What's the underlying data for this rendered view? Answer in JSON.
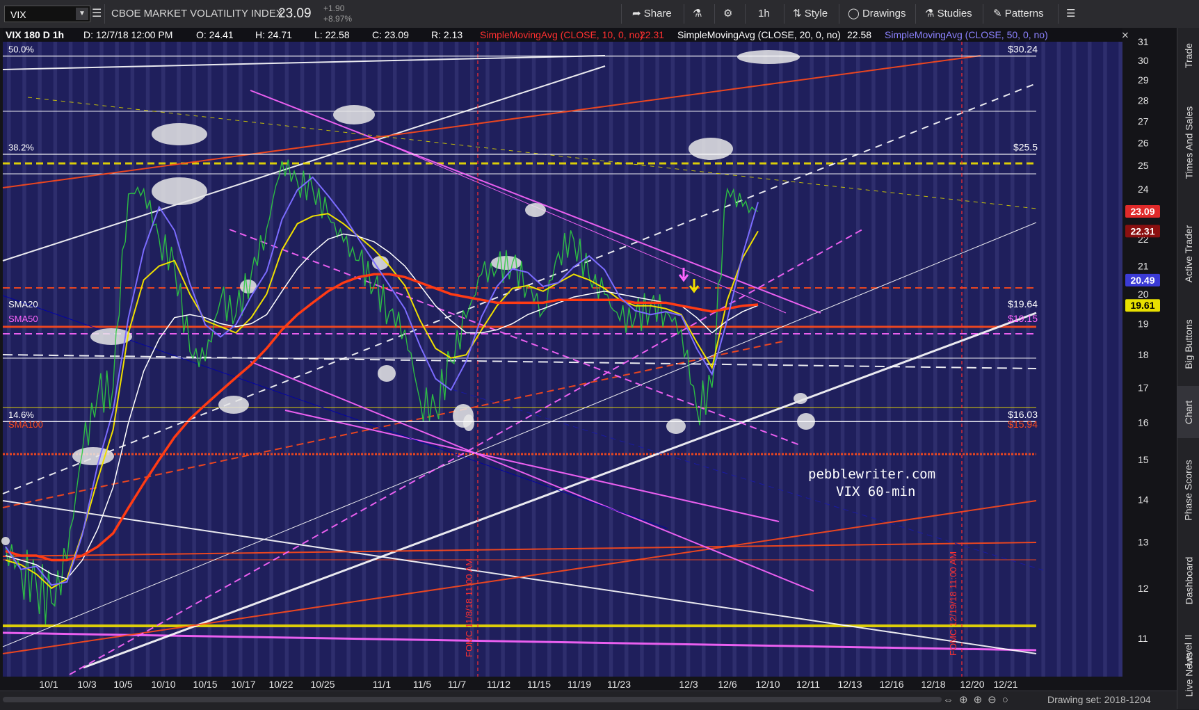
{
  "toolbar": {
    "symbol": "VIX",
    "full_name": "CBOE MARKET VOLATILITY INDEX",
    "last": "23.09",
    "change": "+1.90",
    "change_pct": "+8.97%",
    "share": "Share",
    "timeframe": "1h",
    "style": "Style",
    "drawings": "Drawings",
    "studies": "Studies",
    "patterns": "Patterns"
  },
  "sidebar": [
    "Trade",
    "Times And Sales",
    "Active Trader",
    "Big Buttons",
    "Chart",
    "Phase Scores",
    "Dashboard",
    "Level II",
    "Live News"
  ],
  "bottom": {
    "drawing_set": "Drawing set: 2018-1204"
  },
  "colors": {
    "background": "#1e1e5a",
    "stripe": "#3a3a7c",
    "sma10": "#ff2020",
    "sma20": "#ffffff",
    "sma50": "#7b6cff",
    "yellow": "#f0e000",
    "orange": "#ff4a1a",
    "magenta": "#ff66ff"
  },
  "chart_data": {
    "type": "line",
    "header": {
      "title": "VIX 180 D 1h",
      "date": "D: 12/7/18 12:00 PM",
      "open": "O: 24.41",
      "high": "H: 24.71",
      "low": "L: 22.58",
      "close": "C: 23.09",
      "range": "R: 2.13",
      "study1": "SimpleMovingAvg (CLOSE, 10, 0, no)",
      "study1_val": "22.31",
      "study2": "SimpleMovingAvg (CLOSE, 20, 0, no)",
      "study2_val": "22.58",
      "study3": "SimpleMovingAvg (CLOSE, 50, 0, no)"
    },
    "x_labels": [
      "10/1",
      "10/3",
      "10/5",
      "10/10",
      "10/15",
      "10/17",
      "10/22",
      "10/25",
      "11/1",
      "11/5",
      "11/7",
      "11/12",
      "11/15",
      "11/19",
      "11/23",
      "12/3",
      "12/6",
      "12/10",
      "12/11",
      "12/13",
      "12/16",
      "12/18",
      "12/20",
      "12/21"
    ],
    "y_ticks": [
      11,
      12,
      13,
      14,
      15,
      16,
      17,
      18,
      19,
      20,
      21,
      22,
      23,
      24,
      25,
      26,
      27,
      28,
      29,
      30,
      31
    ],
    "ylim": [
      11,
      31
    ],
    "fib_levels": [
      {
        "label": "50.0%",
        "value": 30.24,
        "price_label": "$30.24"
      },
      {
        "label": "38.2%",
        "value": 25.5,
        "price_label": "$25.5"
      },
      {
        "label": "14.6%",
        "value": 16.03,
        "price_label": "$16.03"
      }
    ],
    "ma_labels": [
      {
        "label": "SMA50",
        "value": 19.15,
        "price_label": "$19.15"
      },
      {
        "label": "SMA100",
        "value": 15.94,
        "price_label": "$15.94"
      },
      {
        "label": "SMA20",
        "value": 19.64,
        "price_label": "$19.64"
      }
    ],
    "price_markers": [
      {
        "value": 23.09,
        "label": "23.09",
        "color": "#e02a2a"
      },
      {
        "value": 22.31,
        "label": "22.31",
        "color": "#8a1010"
      },
      {
        "value": 20.49,
        "label": "20.49",
        "color": "#3b3bd6"
      },
      {
        "value": 19.61,
        "label": "19.61",
        "color": "#e8e000"
      }
    ],
    "vertical_markers": [
      {
        "x": "11/8/18 11:00 AM",
        "label": "FOMC 11/8/18 11:00 AM"
      },
      {
        "x": "12/19/18 11:00 AM",
        "label": "FOMC 12/19/18 11:00 AM"
      }
    ],
    "watermark": [
      "pebblewriter.com",
      "VIX 60-min"
    ],
    "series": [
      {
        "name": "VIX close",
        "x": [
          "9/28",
          "10/1",
          "10/2",
          "10/3",
          "10/4",
          "10/5",
          "10/8",
          "10/9",
          "10/10",
          "10/11",
          "10/12",
          "10/15",
          "10/16",
          "10/17",
          "10/18",
          "10/19",
          "10/22",
          "10/23",
          "10/24",
          "10/25",
          "10/26",
          "10/29",
          "10/30",
          "10/31",
          "11/1",
          "11/2",
          "11/5",
          "11/6",
          "11/7",
          "11/8",
          "11/9",
          "11/12",
          "11/13",
          "11/14",
          "11/15",
          "11/16",
          "11/19",
          "11/20",
          "11/21",
          "11/23",
          "11/26",
          "11/27",
          "11/28",
          "11/29",
          "11/30",
          "12/3",
          "12/4",
          "12/5",
          "12/6",
          "12/7"
        ],
        "values": [
          12.9,
          12.4,
          12.1,
          11.7,
          12.6,
          15.2,
          16.8,
          17.0,
          23.8,
          24.0,
          22.0,
          21.0,
          18.1,
          17.8,
          19.8,
          19.3,
          20.7,
          22.4,
          25.2,
          24.3,
          24.0,
          22.9,
          21.9,
          21.2,
          20.3,
          19.4,
          18.8,
          16.6,
          16.4,
          17.8,
          19.2,
          20.7,
          20.9,
          21.1,
          20.3,
          19.4,
          21.5,
          22.0,
          20.6,
          20.0,
          19.1,
          19.2,
          19.6,
          19.4,
          18.8,
          16.4,
          17.0,
          24.0,
          23.3,
          23.09
        ]
      },
      {
        "name": "SMA10",
        "values": [
          12.6,
          12.5,
          12.3,
          12.0,
          12.2,
          13.2,
          14.5,
          15.8,
          18.7,
          20.5,
          21.0,
          21.2,
          20.0,
          19.1,
          18.9,
          18.7,
          19.2,
          20.0,
          21.6,
          22.6,
          22.9,
          23.0,
          22.6,
          22.1,
          21.6,
          21.0,
          20.3,
          19.1,
          18.2,
          17.9,
          18.0,
          18.8,
          19.6,
          20.2,
          20.3,
          20.1,
          20.4,
          20.7,
          20.5,
          20.2,
          19.8,
          19.6,
          19.6,
          19.5,
          19.3,
          18.4,
          17.6,
          19.8,
          21.3,
          22.31
        ]
      },
      {
        "name": "SMA20",
        "values": [
          12.7,
          12.6,
          12.5,
          12.3,
          12.2,
          12.6,
          13.3,
          14.3,
          16.0,
          17.5,
          18.5,
          19.2,
          19.3,
          19.2,
          19.0,
          18.9,
          19.0,
          19.3,
          20.1,
          20.9,
          21.5,
          22.0,
          22.2,
          22.1,
          21.9,
          21.5,
          21.0,
          20.3,
          19.6,
          19.1,
          18.7,
          18.7,
          18.8,
          19.0,
          19.3,
          19.5,
          19.7,
          19.9,
          20.0,
          20.1,
          20.0,
          19.9,
          19.8,
          19.7,
          19.6,
          19.2,
          18.7,
          19.1,
          19.4,
          19.61
        ]
      },
      {
        "name": "SMA50",
        "values": [
          12.8,
          12.7,
          12.7,
          12.6,
          12.6,
          12.7,
          12.9,
          13.2,
          13.8,
          14.4,
          15.0,
          15.6,
          16.1,
          16.5,
          16.9,
          17.3,
          17.7,
          18.2,
          18.8,
          19.3,
          19.7,
          20.1,
          20.4,
          20.6,
          20.7,
          20.7,
          20.6,
          20.4,
          20.2,
          20.0,
          19.9,
          19.8,
          19.7,
          19.7,
          19.7,
          19.7,
          19.8,
          19.8,
          19.8,
          19.8,
          19.8,
          19.7,
          19.7,
          19.7,
          19.6,
          19.5,
          19.4,
          19.5,
          19.6,
          19.64
        ]
      }
    ]
  }
}
